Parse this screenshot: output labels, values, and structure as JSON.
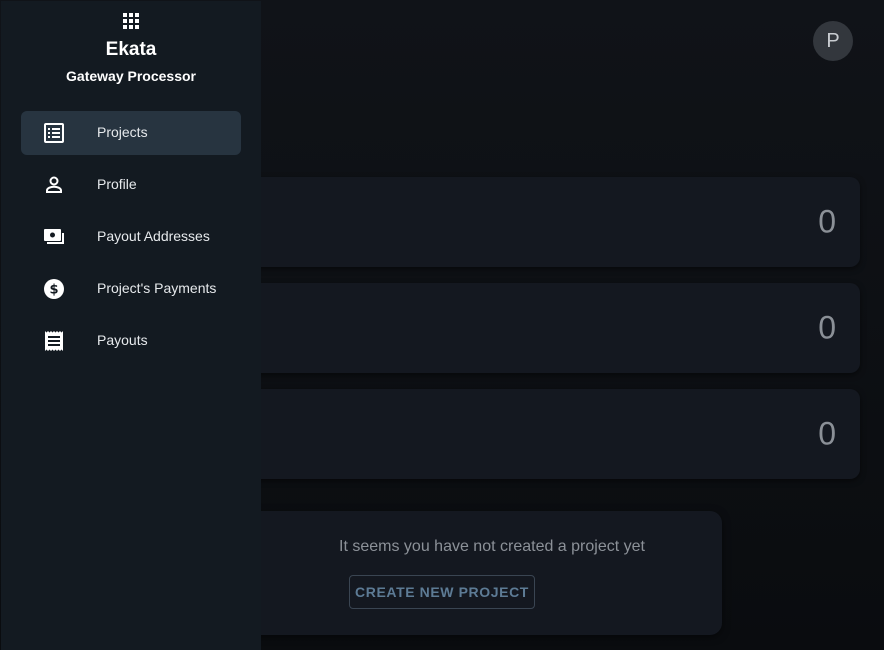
{
  "brand": {
    "title": "Ekata",
    "subtitle": "Gateway Processor",
    "icon": "apps-grid-icon"
  },
  "user": {
    "avatar_initial": "P"
  },
  "sidebar": {
    "items": [
      {
        "label": "Projects",
        "icon": "list-icon",
        "active": true
      },
      {
        "label": "Profile",
        "icon": "person-icon",
        "active": false
      },
      {
        "label": "Payout Addresses",
        "icon": "money-icon",
        "active": false
      },
      {
        "label": "Project's Payments",
        "icon": "dollar-circle-icon",
        "active": false
      },
      {
        "label": "Payouts",
        "icon": "receipt-icon",
        "active": false
      }
    ]
  },
  "stats": [
    {
      "value": "0"
    },
    {
      "value": "0"
    },
    {
      "value": "0"
    }
  ],
  "empty_state": {
    "message": "It seems you have not created a project yet",
    "button_label": "CREATE NEW PROJECT"
  },
  "colors": {
    "sidebar_bg": "#131a21",
    "active_item_bg": "#273440",
    "card_bg": "#141820",
    "button_text": "#5d7b95"
  }
}
